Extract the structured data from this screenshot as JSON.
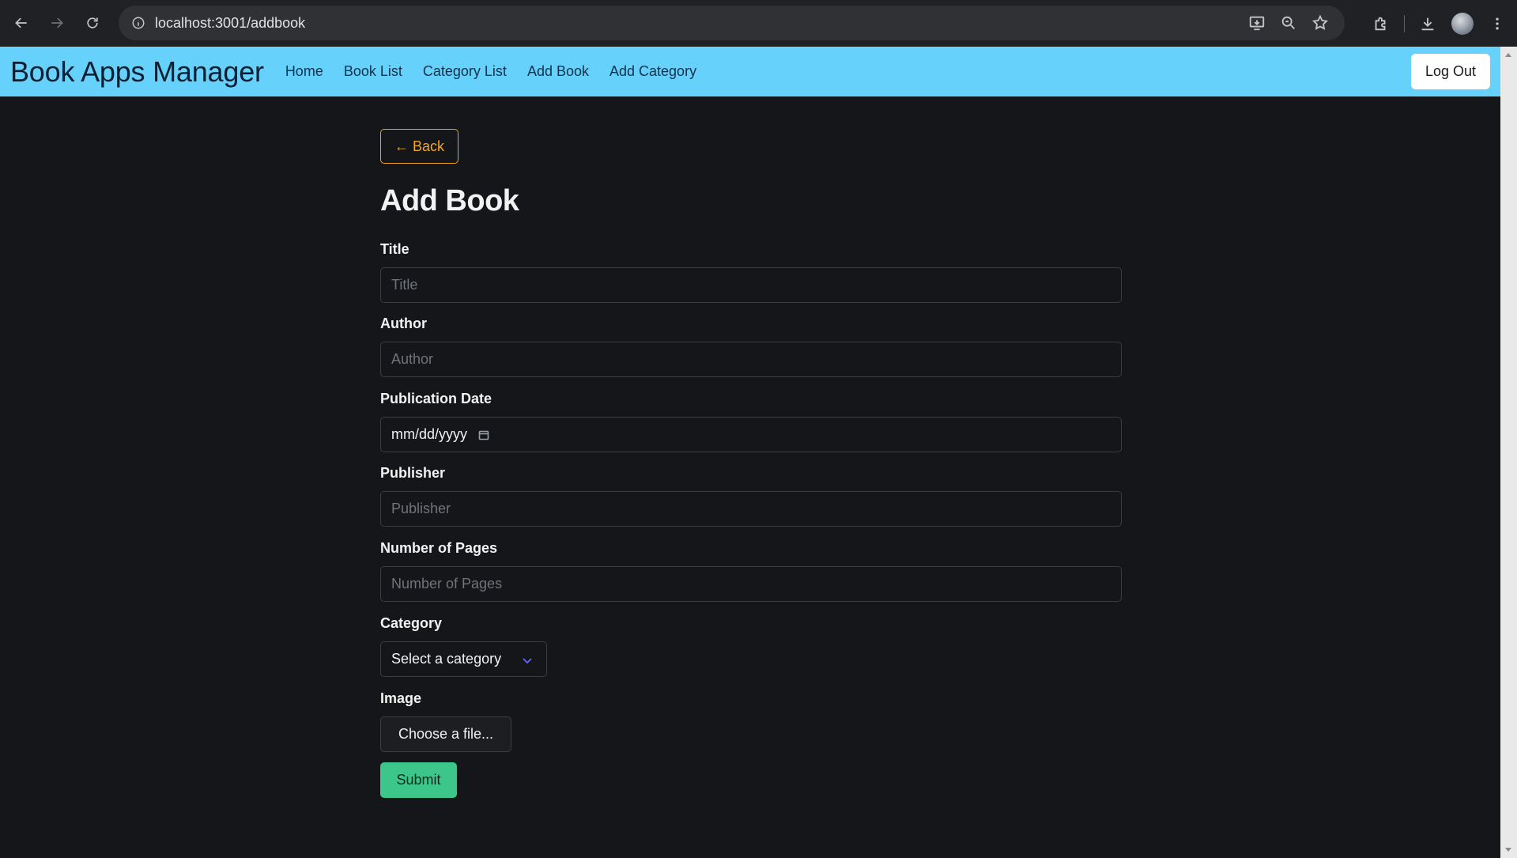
{
  "browser": {
    "url": "localhost:3001/addbook"
  },
  "navbar": {
    "brand": "Book Apps Manager",
    "links": [
      "Home",
      "Book List",
      "Category List",
      "Add Book",
      "Add Category"
    ],
    "logout_label": "Log Out",
    "background_color": "#66d1fb"
  },
  "form": {
    "back_label": "← Back",
    "title": "Add Book",
    "fields": {
      "title": {
        "label": "Title",
        "placeholder": "Title"
      },
      "author": {
        "label": "Author",
        "placeholder": "Author"
      },
      "publication_date": {
        "label": "Publication Date",
        "value": "mm/dd/yyyy"
      },
      "publisher": {
        "label": "Publisher",
        "placeholder": "Publisher"
      },
      "pages": {
        "label": "Number of Pages",
        "placeholder": "Number of Pages"
      },
      "category": {
        "label": "Category",
        "value": "Select a category"
      },
      "image": {
        "label": "Image",
        "button_label": "Choose a file..."
      }
    },
    "submit_label": "Submit"
  },
  "colors": {
    "background": "#141619",
    "accent_back": "#f5a623",
    "submit": "#3cc68a"
  }
}
